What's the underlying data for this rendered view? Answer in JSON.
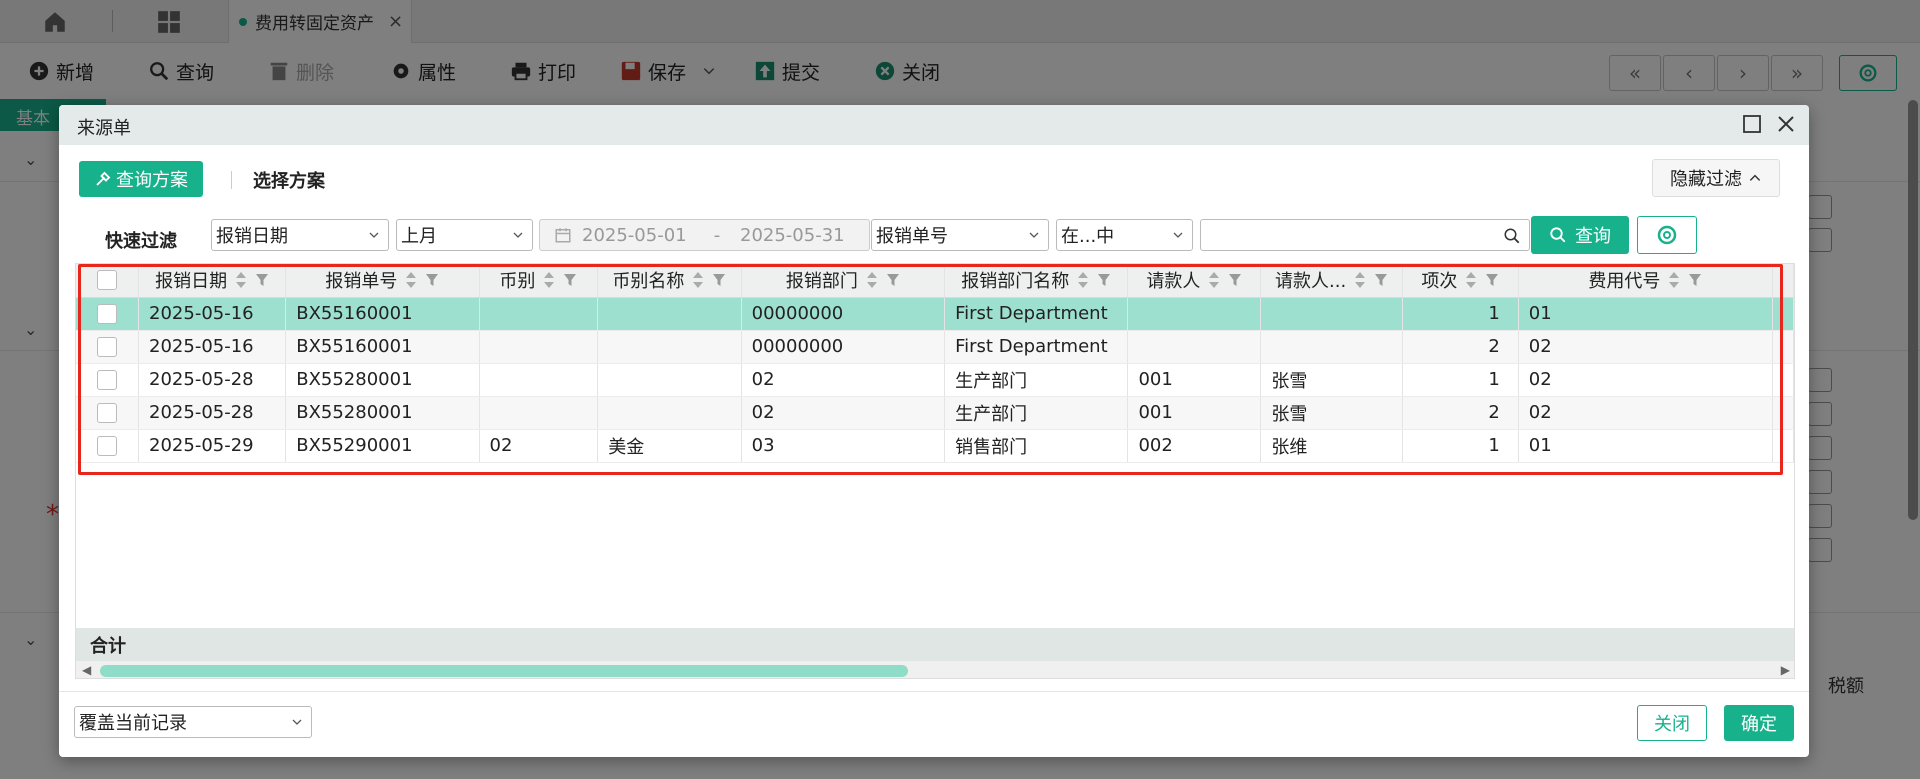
{
  "app": {
    "doc_tab_label": "费用转固定资产",
    "basic_tab_label": "基本",
    "toolbar": {
      "new_label": "新增",
      "query_label": "查询",
      "delete_label": "删除",
      "properties_label": "属性",
      "print_label": "打印",
      "save_label": "保存",
      "submit_label": "提交",
      "close_label": "关闭"
    },
    "bottom_column_label": "税额"
  },
  "dialog": {
    "title": "来源单",
    "scheme_button_label": "查询方案",
    "choose_scheme_label": "选择方案",
    "hide_filter_label": "隐藏过滤",
    "quick_filter_label": "快速过滤",
    "filter": {
      "field1": "报销日期",
      "period": "上月",
      "date_start": "2025-05-01",
      "date_sep": "-",
      "date_end": "2025-05-31",
      "field2": "报销单号",
      "operator": "在...中",
      "value": ""
    },
    "query_button_label": "查询",
    "grid": {
      "columns": [
        "报销日期",
        "报销单号",
        "币别",
        "币别名称",
        "报销部门",
        "报销部门名称",
        "请款人",
        "请款人...",
        "项次",
        "费用代号"
      ],
      "rows": [
        [
          "2025-05-16",
          "BX55160001",
          "",
          "",
          "00000000",
          "First Department",
          "",
          "",
          "1",
          "01"
        ],
        [
          "2025-05-16",
          "BX55160001",
          "",
          "",
          "00000000",
          "First Department",
          "",
          "",
          "2",
          "02"
        ],
        [
          "2025-05-28",
          "BX55280001",
          "",
          "",
          "02",
          "生产部门",
          "001",
          "张雪",
          "1",
          "02"
        ],
        [
          "2025-05-28",
          "BX55280001",
          "",
          "",
          "02",
          "生产部门",
          "001",
          "张雪",
          "2",
          "02"
        ],
        [
          "2025-05-29",
          "BX55290001",
          "02",
          "美金",
          "03",
          "销售部门",
          "002",
          "张维",
          "1",
          "01"
        ]
      ],
      "sum_label": "合计"
    },
    "overwrite_option": "覆盖当前记录",
    "close_button_label": "关闭",
    "ok_button_label": "确定"
  },
  "colors": {
    "accent": "#17b28c",
    "selected_row": "#9ee0cf",
    "highlight_box": "#e8261c"
  }
}
